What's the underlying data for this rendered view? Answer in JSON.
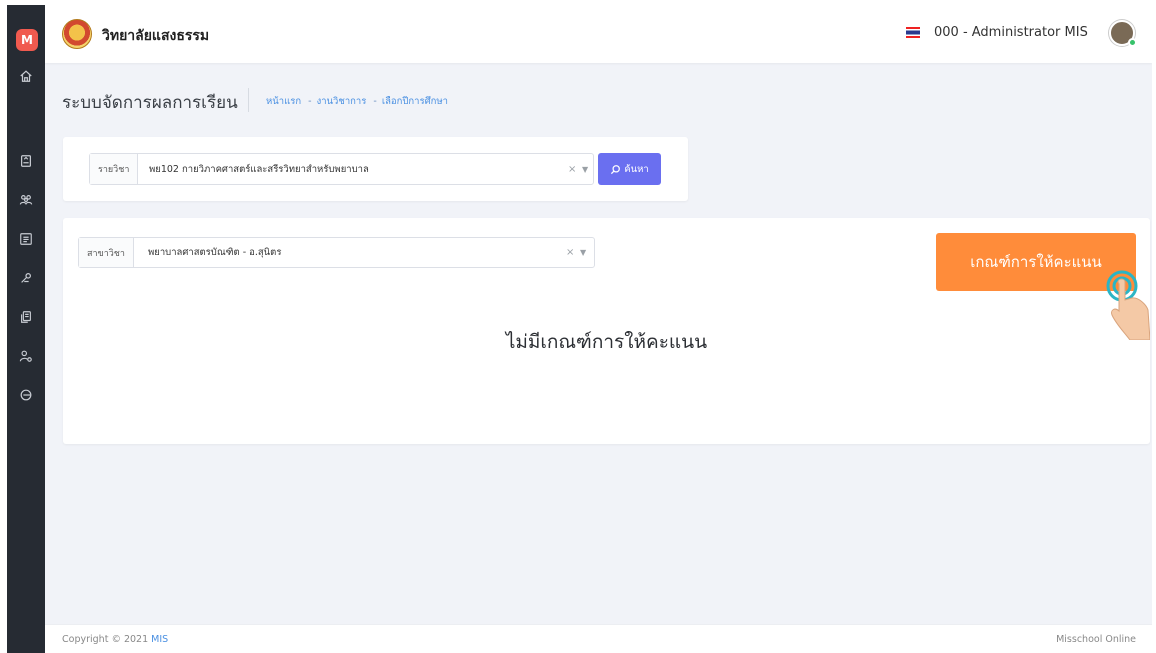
{
  "sidebar": {
    "logo_letter": "M",
    "items": [
      "home-icon",
      "file-icon",
      "users-icon",
      "list-icon",
      "link-icon",
      "document-icon",
      "user-settings-icon",
      "logout-icon"
    ]
  },
  "header": {
    "institution_name": "วิทยาลัยแสงธรรม",
    "user": "000 - Administrator MIS"
  },
  "page": {
    "title": "ระบบจัดการผลการเรียน",
    "breadcrumb": [
      "หน้าแรก",
      "งานวิชาการ",
      "เลือกปีการศึกษา"
    ]
  },
  "search": {
    "subject_label": "รายวิชา",
    "subject_value": "พย102 กายวิภาคศาสตร์และสรีรวิทยาสำหรับพยาบาล",
    "clear": "×",
    "button_label": "ค้นหา"
  },
  "main": {
    "major_label": "สาขาวิชา",
    "major_value": "พยาบาลศาสตรบัณฑิต - อ.สุนิตร",
    "clear": "×",
    "criteria_button": "เกณฑ์การให้คะแนน",
    "empty_message": "ไม่มีเกณฑ์การให้คะแนน"
  },
  "footer": {
    "copyright": "Copyright © 2021 ",
    "brand": "MIS",
    "right": "Misschool Online"
  },
  "colors": {
    "sidebar": "#262b33",
    "accent": "#6a6ff0",
    "orange": "#ff8c3a",
    "logo": "#f05a4f"
  }
}
